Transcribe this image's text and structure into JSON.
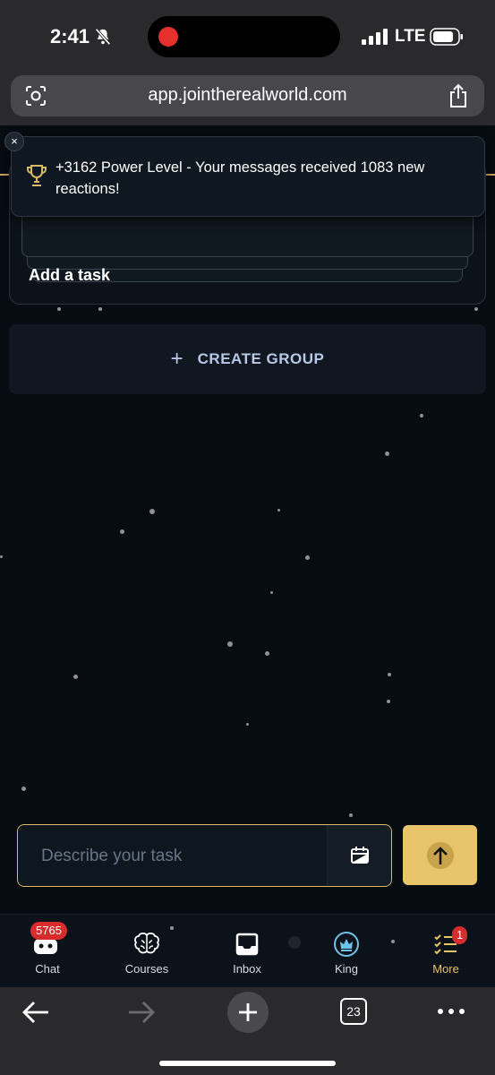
{
  "status": {
    "time": "2:41",
    "network": "LTE"
  },
  "browser": {
    "url": "app.jointherealworld.com",
    "tab_count": "23"
  },
  "notification": {
    "close": "×",
    "text": "+3162 Power Level - Your messages received 1083 new reactions!"
  },
  "tasks": {
    "add_task": "Add a task"
  },
  "create_group": {
    "plus": "+",
    "label": "CREATE GROUP"
  },
  "input": {
    "placeholder": "Describe your task"
  },
  "nav": {
    "items": [
      {
        "label": "Chat",
        "badge": "5765"
      },
      {
        "label": "Courses"
      },
      {
        "label": "Inbox"
      },
      {
        "label": "King"
      },
      {
        "label": "More",
        "badge": "1"
      }
    ]
  },
  "colors": {
    "accent_gold": "#e8c46b",
    "badge_red": "#d72c2c",
    "create_group_text": "#b9c8e8"
  }
}
